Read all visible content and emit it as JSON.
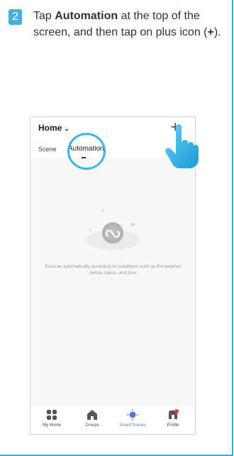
{
  "step": {
    "number": "2"
  },
  "instruction": {
    "part1": "Tap ",
    "bold": "Automation",
    "part2": " at the top of the screen, and then tap on plus icon (",
    "plus": "+",
    "part3": ")."
  },
  "phone": {
    "header": {
      "home_label": "Home",
      "chevron": "⌄",
      "plus_symbol": "+",
      "tabs": [
        {
          "label": "Scene",
          "active": false
        },
        {
          "label": "Automation",
          "active": true
        }
      ]
    },
    "empty_state": {
      "message": "Execute automatically according to conditions such as the weather, device status, and time."
    },
    "tabbar": [
      {
        "label": "My Home",
        "icon": "grid-icon",
        "active": false
      },
      {
        "label": "Groups",
        "icon": "house-icon",
        "active": false
      },
      {
        "label": "Smart Scenes",
        "icon": "sun-icon",
        "active": true
      },
      {
        "label": "Profile",
        "icon": "profile-icon",
        "active": false
      }
    ]
  },
  "colors": {
    "accent": "#45aede",
    "highlight": "#39b6e6",
    "active_tab": "#5a74d6"
  }
}
